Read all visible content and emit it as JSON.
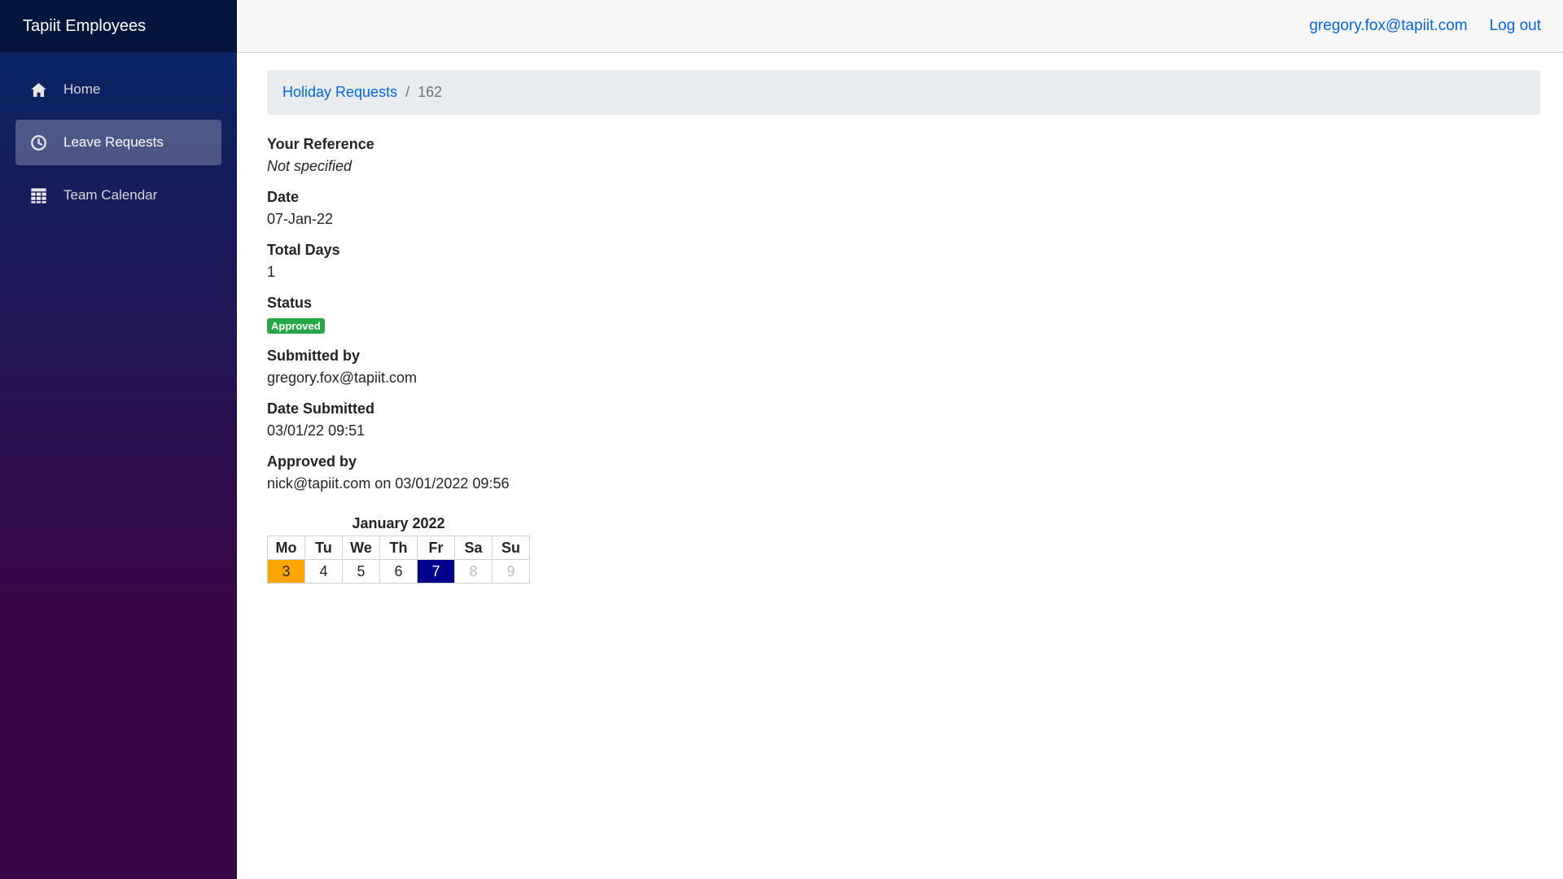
{
  "app": {
    "brand": "Tapiit Employees"
  },
  "topbar": {
    "user_email": "gregory.fox@tapiit.com",
    "logout_label": "Log out"
  },
  "sidebar": {
    "items": [
      {
        "label": "Home",
        "icon": "home-icon",
        "active": false
      },
      {
        "label": "Leave Requests",
        "icon": "clock-icon",
        "active": true
      },
      {
        "label": "Team Calendar",
        "icon": "calendar-icon",
        "active": false
      }
    ]
  },
  "breadcrumb": {
    "parent": "Holiday Requests",
    "separator": "/",
    "current": "162"
  },
  "details": {
    "reference_label": "Your Reference",
    "reference_value": "Not specified",
    "date_label": "Date",
    "date_value": "07-Jan-22",
    "total_days_label": "Total Days",
    "total_days_value": "1",
    "status_label": "Status",
    "status_value": "Approved",
    "submitted_by_label": "Submitted by",
    "submitted_by_value": "gregory.fox@tapiit.com",
    "date_submitted_label": "Date Submitted",
    "date_submitted_value": "03/01/22 09:51",
    "approved_by_label": "Approved by",
    "approved_by_value": "nick@tapiit.com on 03/01/2022 09:56"
  },
  "calendar": {
    "title": "January 2022",
    "weekdays": [
      "Mo",
      "Tu",
      "We",
      "Th",
      "Fr",
      "Sa",
      "Su"
    ],
    "days": [
      "3",
      "4",
      "5",
      "6",
      "7",
      "8",
      "9"
    ]
  },
  "colors": {
    "status_approved": "#28a745",
    "calendar_week_start": "#ffa500",
    "calendar_selected": "#00008b",
    "link": "#0366d6"
  }
}
